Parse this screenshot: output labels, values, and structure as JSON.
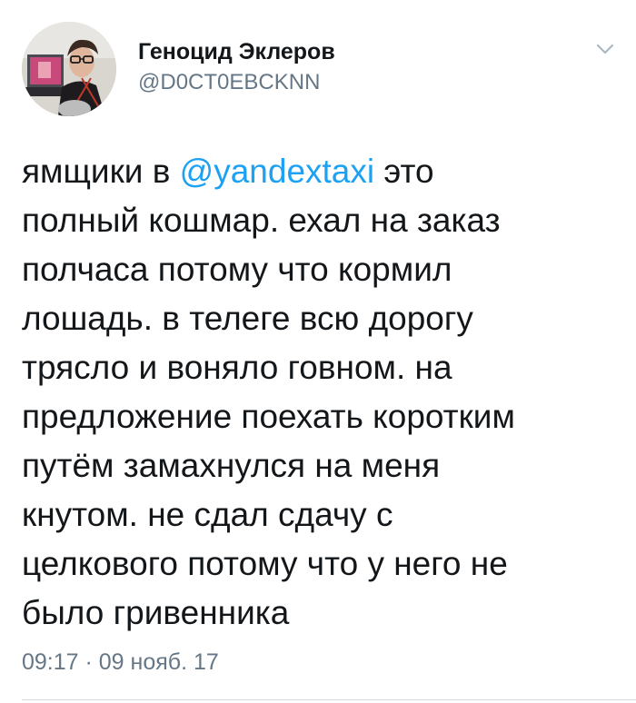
{
  "author": {
    "display_name": "Геноцид Эклеров",
    "handle": "@D0CT0EBCKNN"
  },
  "tweet": {
    "text_before": "ямщики в ",
    "mention": "@yandextaxi",
    "text_after": " это\nполный кошмар. ехал на заказ\nполчаса потому что кормил\nлошадь. в телеге всю дорогу\nтрясло и воняло говном. на\nпредложение поехать коротким\nпутём замахнулся на меня\nкнутом. не сдал сдачу с\nцелкового потому что у него не\nбыло гривенника",
    "time": "09:17",
    "separator": " · ",
    "date": "09 нояб. 17"
  },
  "icons": {
    "menu": "chevron-down-icon",
    "avatar": "avatar-photo"
  },
  "colors": {
    "text": "#14171a",
    "secondary": "#657786",
    "link": "#1da1f2",
    "caret": "#aab8c2",
    "divider": "#cfd9de"
  }
}
